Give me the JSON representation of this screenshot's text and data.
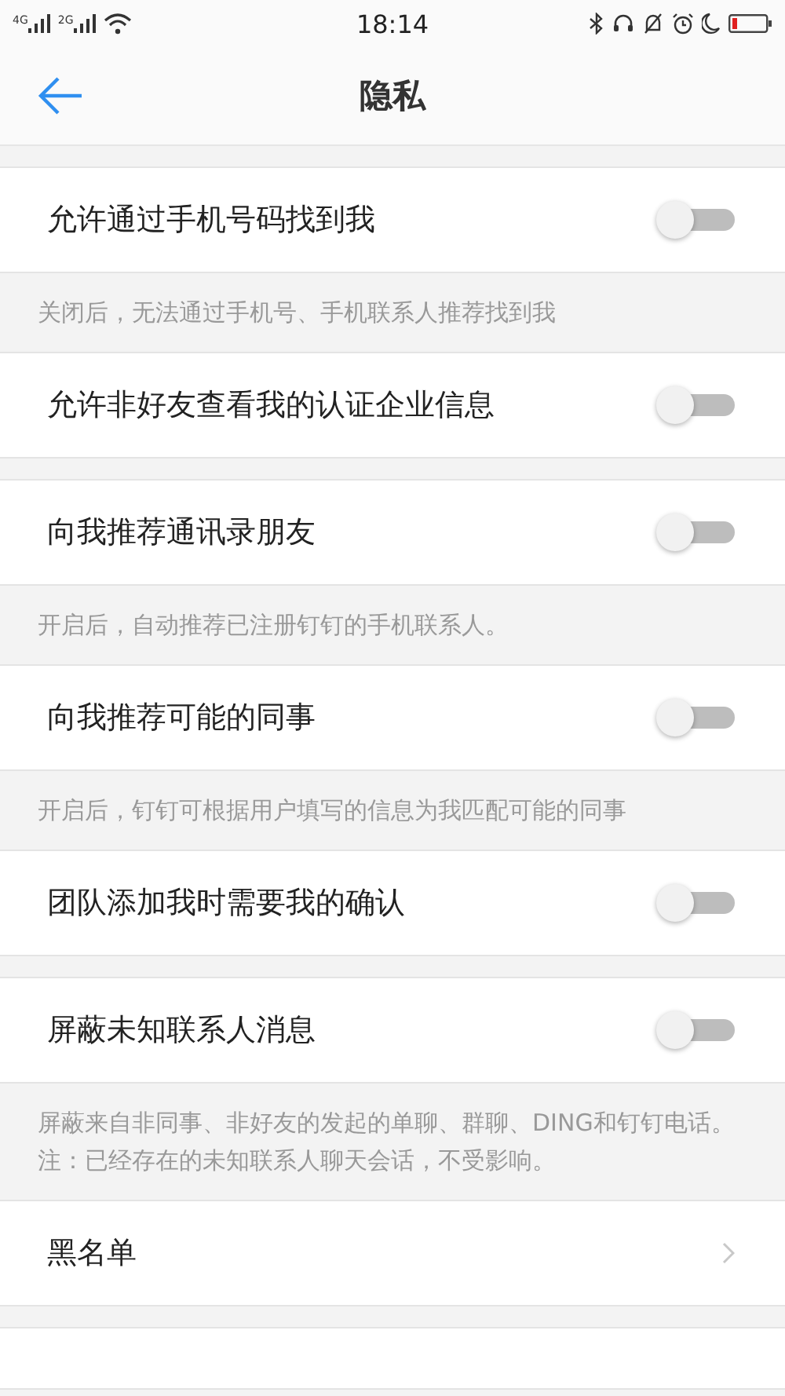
{
  "status_bar": {
    "networks": [
      "4G",
      "2G"
    ],
    "time": "18:14"
  },
  "header": {
    "title": "隐私"
  },
  "sections": [
    {
      "rows": [
        {
          "kind": "toggle",
          "label": "允许通过手机号码找到我",
          "on": false
        }
      ],
      "note": "关闭后，无法通过手机号、手机联系人推荐找到我"
    },
    {
      "rows": [
        {
          "kind": "toggle",
          "label": "允许非好友查看我的认证企业信息",
          "on": false
        }
      ]
    },
    {
      "rows": [
        {
          "kind": "toggle",
          "label": "向我推荐通讯录朋友",
          "on": false
        }
      ],
      "note": "开启后，自动推荐已注册钉钉的手机联系人。"
    },
    {
      "rows": [
        {
          "kind": "toggle",
          "label": "向我推荐可能的同事",
          "on": false
        }
      ],
      "note": "开启后，钉钉可根据用户填写的信息为我匹配可能的同事"
    },
    {
      "rows": [
        {
          "kind": "toggle",
          "label": "团队添加我时需要我的确认",
          "on": false
        }
      ]
    },
    {
      "rows": [
        {
          "kind": "toggle",
          "label": "屏蔽未知联系人消息",
          "on": false
        }
      ],
      "note": "屏蔽来自非同事、非好友的发起的单聊、群聊、DING和钉钉电话。注：已经存在的未知联系人聊天会话，不受影响。"
    },
    {
      "rows": [
        {
          "kind": "link",
          "label": "黑名单"
        }
      ]
    }
  ]
}
